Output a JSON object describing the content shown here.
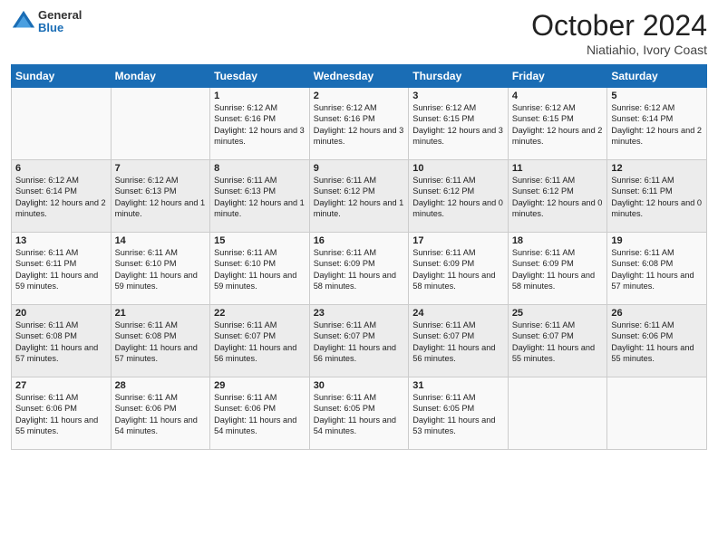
{
  "logo": {
    "general": "General",
    "blue": "Blue"
  },
  "header": {
    "month": "October 2024",
    "location": "Niatiahio, Ivory Coast"
  },
  "days_of_week": [
    "Sunday",
    "Monday",
    "Tuesday",
    "Wednesday",
    "Thursday",
    "Friday",
    "Saturday"
  ],
  "weeks": [
    [
      {
        "day": "",
        "sunrise": "",
        "sunset": "",
        "daylight": ""
      },
      {
        "day": "",
        "sunrise": "",
        "sunset": "",
        "daylight": ""
      },
      {
        "day": "1",
        "sunrise": "Sunrise: 6:12 AM",
        "sunset": "Sunset: 6:16 PM",
        "daylight": "Daylight: 12 hours and 3 minutes."
      },
      {
        "day": "2",
        "sunrise": "Sunrise: 6:12 AM",
        "sunset": "Sunset: 6:16 PM",
        "daylight": "Daylight: 12 hours and 3 minutes."
      },
      {
        "day": "3",
        "sunrise": "Sunrise: 6:12 AM",
        "sunset": "Sunset: 6:15 PM",
        "daylight": "Daylight: 12 hours and 3 minutes."
      },
      {
        "day": "4",
        "sunrise": "Sunrise: 6:12 AM",
        "sunset": "Sunset: 6:15 PM",
        "daylight": "Daylight: 12 hours and 2 minutes."
      },
      {
        "day": "5",
        "sunrise": "Sunrise: 6:12 AM",
        "sunset": "Sunset: 6:14 PM",
        "daylight": "Daylight: 12 hours and 2 minutes."
      }
    ],
    [
      {
        "day": "6",
        "sunrise": "Sunrise: 6:12 AM",
        "sunset": "Sunset: 6:14 PM",
        "daylight": "Daylight: 12 hours and 2 minutes."
      },
      {
        "day": "7",
        "sunrise": "Sunrise: 6:12 AM",
        "sunset": "Sunset: 6:13 PM",
        "daylight": "Daylight: 12 hours and 1 minute."
      },
      {
        "day": "8",
        "sunrise": "Sunrise: 6:11 AM",
        "sunset": "Sunset: 6:13 PM",
        "daylight": "Daylight: 12 hours and 1 minute."
      },
      {
        "day": "9",
        "sunrise": "Sunrise: 6:11 AM",
        "sunset": "Sunset: 6:12 PM",
        "daylight": "Daylight: 12 hours and 1 minute."
      },
      {
        "day": "10",
        "sunrise": "Sunrise: 6:11 AM",
        "sunset": "Sunset: 6:12 PM",
        "daylight": "Daylight: 12 hours and 0 minutes."
      },
      {
        "day": "11",
        "sunrise": "Sunrise: 6:11 AM",
        "sunset": "Sunset: 6:12 PM",
        "daylight": "Daylight: 12 hours and 0 minutes."
      },
      {
        "day": "12",
        "sunrise": "Sunrise: 6:11 AM",
        "sunset": "Sunset: 6:11 PM",
        "daylight": "Daylight: 12 hours and 0 minutes."
      }
    ],
    [
      {
        "day": "13",
        "sunrise": "Sunrise: 6:11 AM",
        "sunset": "Sunset: 6:11 PM",
        "daylight": "Daylight: 11 hours and 59 minutes."
      },
      {
        "day": "14",
        "sunrise": "Sunrise: 6:11 AM",
        "sunset": "Sunset: 6:10 PM",
        "daylight": "Daylight: 11 hours and 59 minutes."
      },
      {
        "day": "15",
        "sunrise": "Sunrise: 6:11 AM",
        "sunset": "Sunset: 6:10 PM",
        "daylight": "Daylight: 11 hours and 59 minutes."
      },
      {
        "day": "16",
        "sunrise": "Sunrise: 6:11 AM",
        "sunset": "Sunset: 6:09 PM",
        "daylight": "Daylight: 11 hours and 58 minutes."
      },
      {
        "day": "17",
        "sunrise": "Sunrise: 6:11 AM",
        "sunset": "Sunset: 6:09 PM",
        "daylight": "Daylight: 11 hours and 58 minutes."
      },
      {
        "day": "18",
        "sunrise": "Sunrise: 6:11 AM",
        "sunset": "Sunset: 6:09 PM",
        "daylight": "Daylight: 11 hours and 58 minutes."
      },
      {
        "day": "19",
        "sunrise": "Sunrise: 6:11 AM",
        "sunset": "Sunset: 6:08 PM",
        "daylight": "Daylight: 11 hours and 57 minutes."
      }
    ],
    [
      {
        "day": "20",
        "sunrise": "Sunrise: 6:11 AM",
        "sunset": "Sunset: 6:08 PM",
        "daylight": "Daylight: 11 hours and 57 minutes."
      },
      {
        "day": "21",
        "sunrise": "Sunrise: 6:11 AM",
        "sunset": "Sunset: 6:08 PM",
        "daylight": "Daylight: 11 hours and 57 minutes."
      },
      {
        "day": "22",
        "sunrise": "Sunrise: 6:11 AM",
        "sunset": "Sunset: 6:07 PM",
        "daylight": "Daylight: 11 hours and 56 minutes."
      },
      {
        "day": "23",
        "sunrise": "Sunrise: 6:11 AM",
        "sunset": "Sunset: 6:07 PM",
        "daylight": "Daylight: 11 hours and 56 minutes."
      },
      {
        "day": "24",
        "sunrise": "Sunrise: 6:11 AM",
        "sunset": "Sunset: 6:07 PM",
        "daylight": "Daylight: 11 hours and 56 minutes."
      },
      {
        "day": "25",
        "sunrise": "Sunrise: 6:11 AM",
        "sunset": "Sunset: 6:07 PM",
        "daylight": "Daylight: 11 hours and 55 minutes."
      },
      {
        "day": "26",
        "sunrise": "Sunrise: 6:11 AM",
        "sunset": "Sunset: 6:06 PM",
        "daylight": "Daylight: 11 hours and 55 minutes."
      }
    ],
    [
      {
        "day": "27",
        "sunrise": "Sunrise: 6:11 AM",
        "sunset": "Sunset: 6:06 PM",
        "daylight": "Daylight: 11 hours and 55 minutes."
      },
      {
        "day": "28",
        "sunrise": "Sunrise: 6:11 AM",
        "sunset": "Sunset: 6:06 PM",
        "daylight": "Daylight: 11 hours and 54 minutes."
      },
      {
        "day": "29",
        "sunrise": "Sunrise: 6:11 AM",
        "sunset": "Sunset: 6:06 PM",
        "daylight": "Daylight: 11 hours and 54 minutes."
      },
      {
        "day": "30",
        "sunrise": "Sunrise: 6:11 AM",
        "sunset": "Sunset: 6:05 PM",
        "daylight": "Daylight: 11 hours and 54 minutes."
      },
      {
        "day": "31",
        "sunrise": "Sunrise: 6:11 AM",
        "sunset": "Sunset: 6:05 PM",
        "daylight": "Daylight: 11 hours and 53 minutes."
      },
      {
        "day": "",
        "sunrise": "",
        "sunset": "",
        "daylight": ""
      },
      {
        "day": "",
        "sunrise": "",
        "sunset": "",
        "daylight": ""
      }
    ]
  ]
}
